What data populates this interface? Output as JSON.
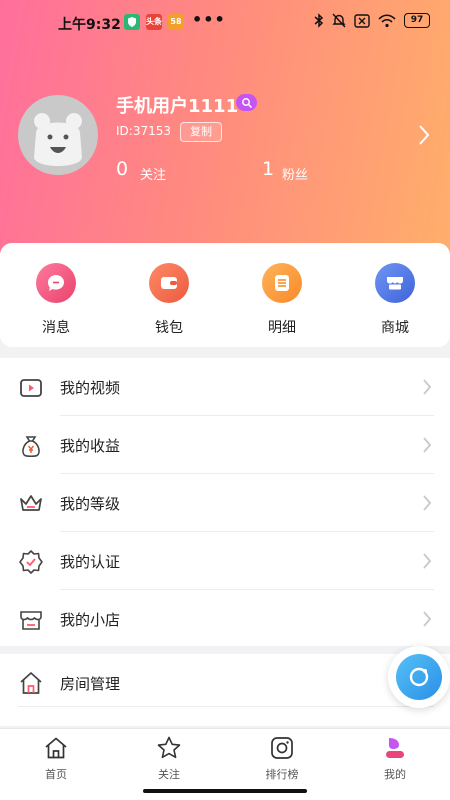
{
  "status": {
    "time": "上午9:32",
    "apps": [
      {
        "icon": "shield-app-icon",
        "text": "",
        "color": "#2bb673"
      },
      {
        "icon": "toutiao-app-icon",
        "text": "头条",
        "color": "#e8423b"
      },
      {
        "icon": "58-app-icon",
        "text": "58",
        "color": "#f2a02b"
      }
    ],
    "dots": "•••",
    "battery": "97"
  },
  "profile": {
    "name": "手机用户1111",
    "id_text": "ID:37153",
    "copy_label": "复制",
    "follow_count": "0",
    "follow_label": "关注",
    "fans_count": "1",
    "fans_label": "粉丝"
  },
  "quick_actions": [
    {
      "label": "消息",
      "icon": "message-icon",
      "color": "#f0507a"
    },
    {
      "label": "钱包",
      "icon": "wallet-icon",
      "color": "#f46a50"
    },
    {
      "label": "明细",
      "icon": "list-icon",
      "color": "#f89a3a"
    },
    {
      "label": "商城",
      "icon": "store-icon",
      "color": "#4f78e8"
    }
  ],
  "menu": [
    {
      "label": "我的视频",
      "icon": "video-icon"
    },
    {
      "label": "我的收益",
      "icon": "money-bag-icon"
    },
    {
      "label": "我的等级",
      "icon": "crown-icon"
    },
    {
      "label": "我的认证",
      "icon": "verified-badge-icon"
    },
    {
      "label": "我的小店",
      "icon": "shop-icon"
    }
  ],
  "room": {
    "label": "房间管理",
    "icon": "house-icon"
  },
  "tabs": [
    {
      "label": "首页",
      "icon": "home-icon"
    },
    {
      "label": "关注",
      "icon": "star-icon"
    },
    {
      "label": "排行榜",
      "icon": "camera-icon"
    },
    {
      "label": "我的",
      "icon": "profile-icon",
      "active": true
    }
  ],
  "colors": {
    "header_start": "#ff6f9c",
    "header_end": "#ffae6b",
    "accent_purple": "#c455f2",
    "float_blue": "#2b8fe6"
  }
}
